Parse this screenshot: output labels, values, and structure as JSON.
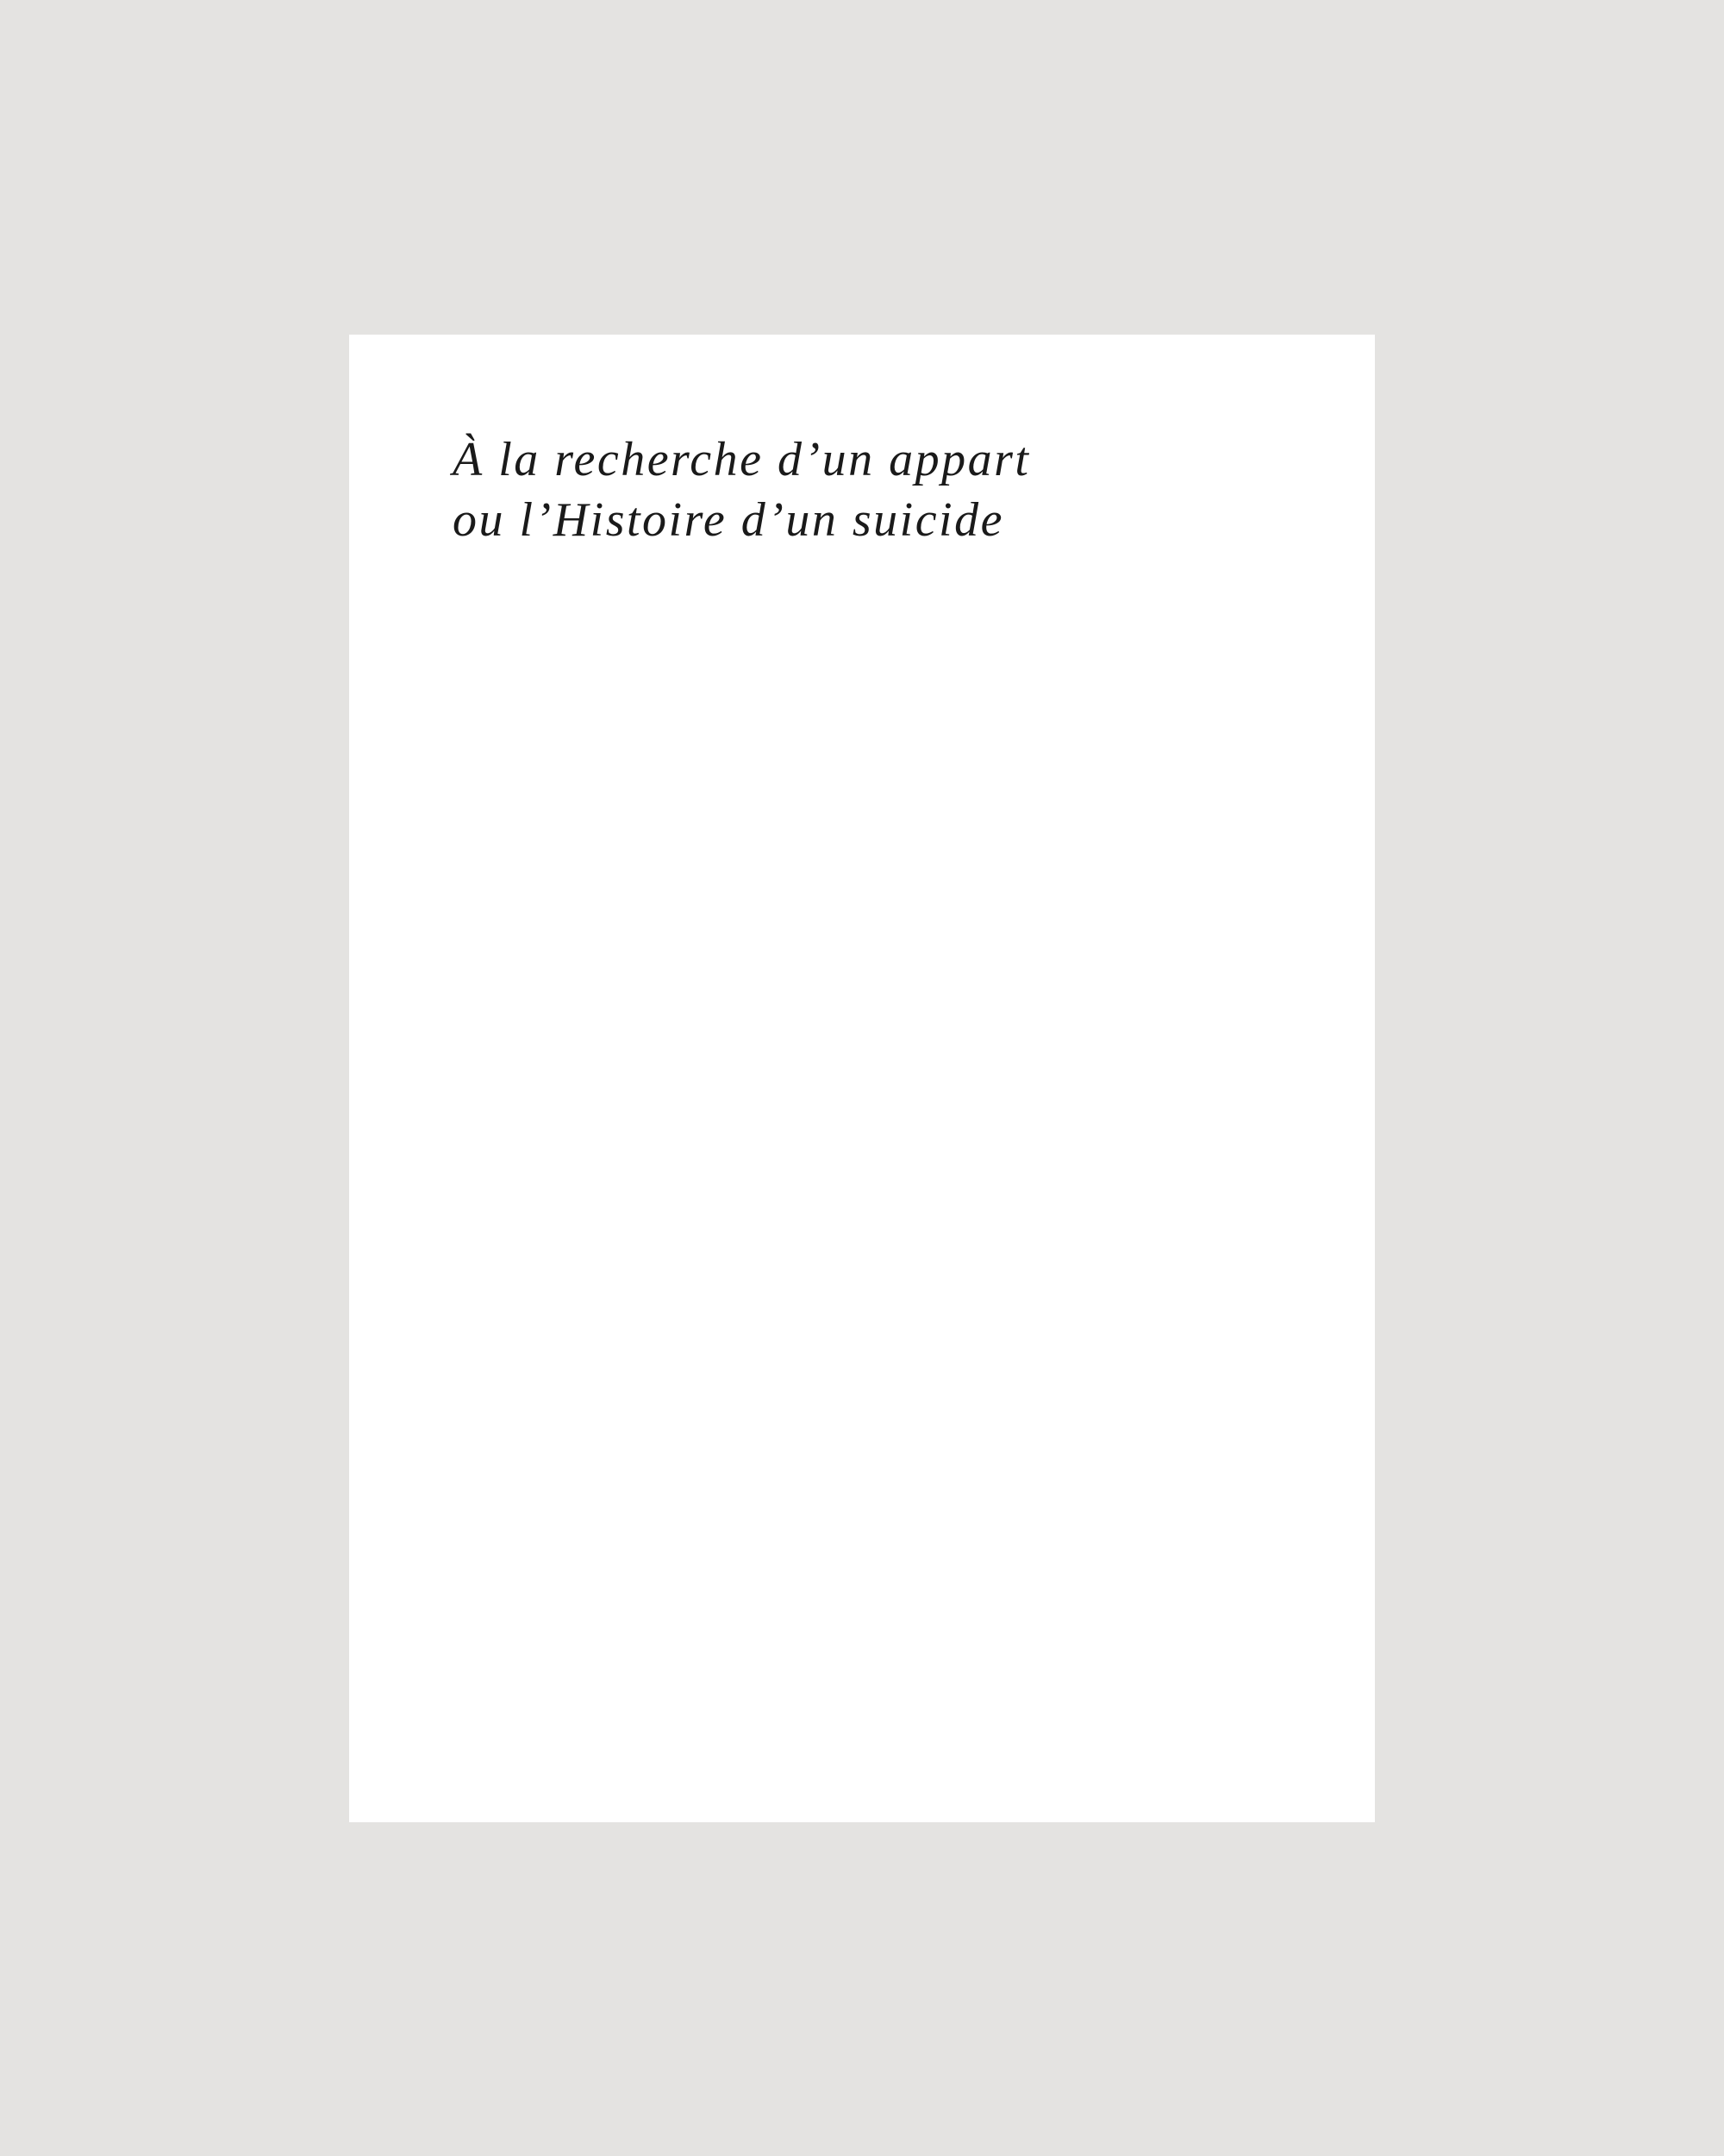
{
  "document": {
    "title_lines": [
      "À la recherche d’un appart",
      "ou l’Histoire d’un suicide"
    ]
  },
  "colors": {
    "background": "#e4e3e1",
    "page": "#ffffff",
    "text": "#1a1a1a"
  }
}
